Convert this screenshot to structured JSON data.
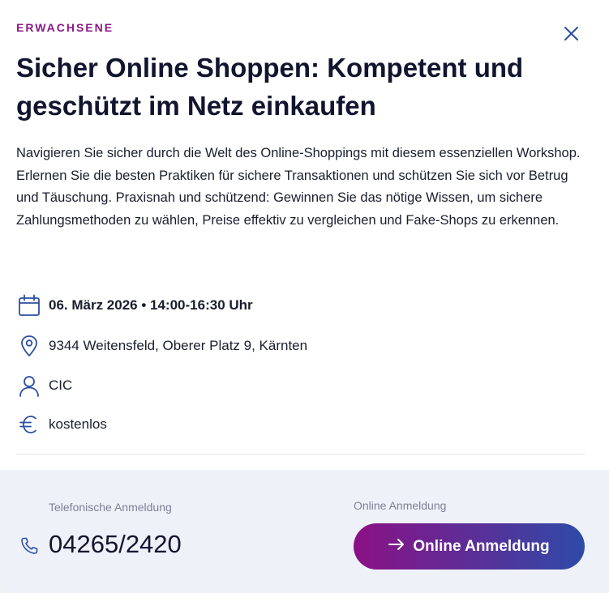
{
  "event": {
    "category": "ERWACHSENE",
    "title": "Sicher Online Shoppen: Kompetent und geschützt im Netz einkaufen",
    "description": "Navigieren Sie sicher durch die Welt des Online-Shoppings mit diesem essenziellen Workshop. Erlernen Sie die besten Praktiken für sichere Transaktionen und schützen Sie sich vor Betrug und Täuschung. Praxisnah und schützend: Gewinnen Sie das nötige Wissen, um sichere Zahlungsmethoden zu wählen, Preise effektiv zu vergleichen und Fake-Shops zu erkennen.",
    "date_time": "06. März 2026 • 14:00-16:30 Uhr",
    "location": "9344 Weitensfeld, Oberer Platz 9, Kärnten",
    "organizer": "CIC",
    "price": "kostenlos"
  },
  "registration": {
    "phone_label": "Telefonische Anmeldung",
    "phone_number": "04265/2420",
    "online_label": "Online Anmeldung",
    "online_button": "Online Anmeldung"
  },
  "icons": {
    "close": "close-icon",
    "date": "calendar-icon",
    "location": "location-pin-icon",
    "organizer": "person-icon",
    "price": "euro-icon",
    "phone": "phone-icon",
    "button_arrow": "arrow-right-icon"
  },
  "colors": {
    "category": "#8a1a86",
    "icon_blue": "#2b4ea2",
    "button_gradient_start": "#8b1185",
    "button_gradient_end": "#2e4aa8",
    "footer_bg": "#eef1f8"
  }
}
